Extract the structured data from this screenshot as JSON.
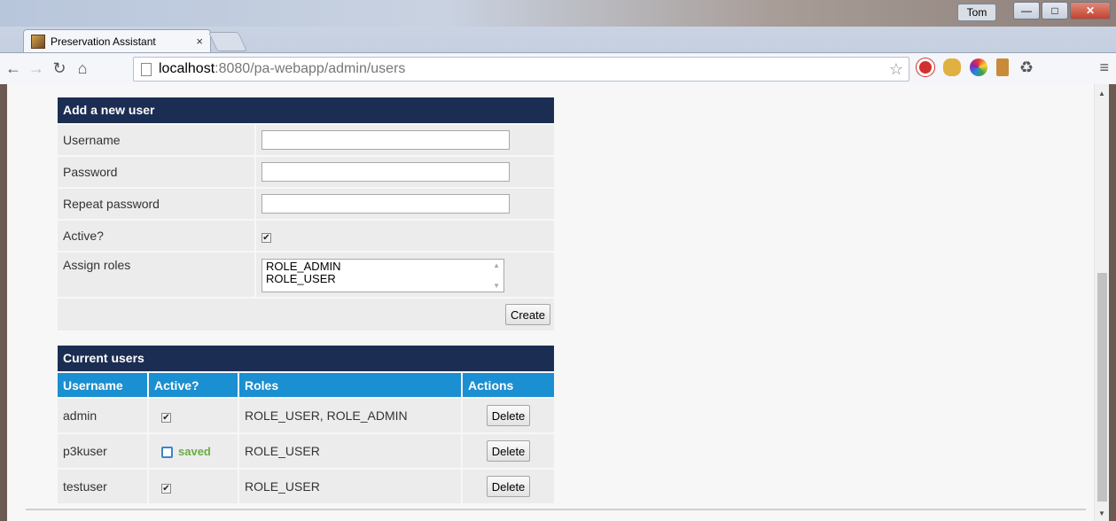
{
  "browser": {
    "tab_title": "Preservation Assistant",
    "tab_close": "×",
    "profile": "Tom",
    "url_host": "localhost",
    "url_path": ":8080/pa-webapp/admin/users"
  },
  "add_user": {
    "title": "Add a new user",
    "username_label": "Username",
    "password_label": "Password",
    "repeat_label": "Repeat password",
    "active_label": "Active?",
    "roles_label": "Assign roles",
    "role_options": [
      "ROLE_ADMIN",
      "ROLE_USER"
    ],
    "create_label": "Create"
  },
  "current_users": {
    "title": "Current users",
    "columns": [
      "Username",
      "Active?",
      "Roles",
      "Actions"
    ],
    "rows": [
      {
        "username": "admin",
        "active": true,
        "roles": "ROLE_USER, ROLE_ADMIN",
        "action": "Delete",
        "status": ""
      },
      {
        "username": "p3kuser",
        "active": false,
        "roles": "ROLE_USER",
        "action": "Delete",
        "status": "saved"
      },
      {
        "username": "testuser",
        "active": true,
        "roles": "ROLE_USER",
        "action": "Delete",
        "status": ""
      }
    ]
  }
}
